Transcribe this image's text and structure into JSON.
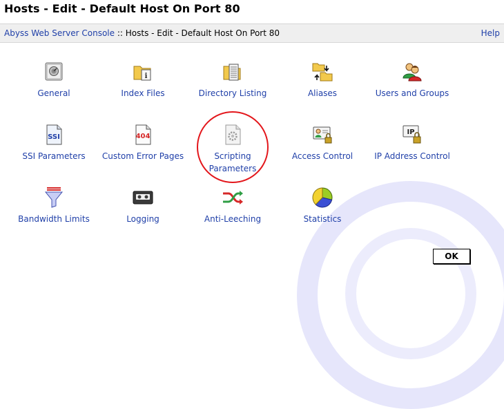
{
  "page": {
    "title": "Hosts - Edit - Default Host On Port 80"
  },
  "breadcrumb": {
    "console_link": "Abyss Web Server Console",
    "separator": " :: ",
    "current": "Hosts - Edit - Default Host On Port 80",
    "help": "Help"
  },
  "tiles": {
    "general": "General",
    "index_files": "Index Files",
    "directory_listing": "Directory Listing",
    "aliases": "Aliases",
    "users_and_groups": "Users and Groups",
    "ssi_parameters": "SSI Parameters",
    "custom_error_pages": "Custom Error Pages",
    "scripting_parameters_line1": "Scripting",
    "scripting_parameters_line2": "Parameters",
    "access_control": "Access Control",
    "ip_address_control": "IP Address Control",
    "bandwidth_limits": "Bandwidth Limits",
    "logging": "Logging",
    "anti_leeching": "Anti-Leeching",
    "statistics": "Statistics"
  },
  "icon_text": {
    "ssi": "SSI",
    "error_code": "404",
    "ip": "IP"
  },
  "buttons": {
    "ok": "OK"
  },
  "colors": {
    "link": "#1f3fa8",
    "highlight_ring": "#e3161b",
    "watermark": "#e6e6fb",
    "breadcrumb_bg": "#efefef"
  }
}
